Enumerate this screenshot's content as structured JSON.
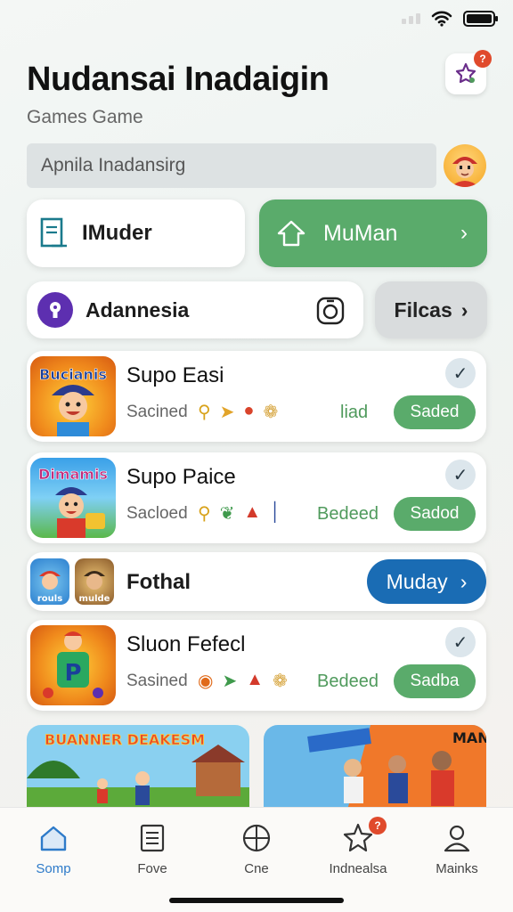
{
  "header": {
    "title": "Nudansai Inadaigin",
    "subtitle": "Games Game",
    "notification_count": "?"
  },
  "search": {
    "value": "Apnila Inadansirg"
  },
  "actions": {
    "primary_left_label": "IMuder",
    "primary_right_label": "MuMan",
    "secondary_left_label": "Adannesia",
    "secondary_right_label": "Filcas"
  },
  "games": [
    {
      "title": "Supo Easi",
      "thumb_text": "Bucianis",
      "meta": "Sacined",
      "status": "liad",
      "action": "Saded",
      "icons": [
        "key-icon",
        "horn-icon",
        "flame-icon",
        "shell-icon"
      ]
    },
    {
      "title": "Supo Paice",
      "thumb_text": "Dimamis",
      "meta": "Sacloed",
      "status": "Bedeed",
      "action": "Sadod",
      "icons": [
        "key-icon",
        "leaf-icon",
        "cone-icon",
        "pin-icon"
      ]
    },
    {
      "title": "Sluon Fefecl",
      "thumb_text": "P",
      "meta": "Sasined",
      "status": "Bedeed",
      "action": "Sadba",
      "icons": [
        "pumpkin-icon",
        "leaf-icon",
        "warning-icon",
        "pretzel-icon"
      ]
    }
  ],
  "featured": {
    "title": "Fothal",
    "thumb_text_1": "rouls",
    "thumb_text_2": "mulde",
    "action": "Muday"
  },
  "banners": [
    {
      "text": "BUANNER DEAKESM"
    },
    {
      "text": "MAN"
    }
  ],
  "tabs": [
    {
      "label": "Somp",
      "icon": "home-icon",
      "active": true
    },
    {
      "label": "Fove",
      "icon": "document-icon",
      "active": false
    },
    {
      "label": "Cne",
      "icon": "compass-icon",
      "active": false
    },
    {
      "label": "Indnealsa",
      "icon": "star-icon",
      "active": false,
      "badge": "?"
    },
    {
      "label": "Mainks",
      "icon": "person-icon",
      "active": false
    }
  ],
  "colors": {
    "accent_green": "#5aab6b",
    "accent_blue": "#1a6cb4",
    "badge_red": "#e04a2c",
    "tab_active": "#2d7ac9"
  }
}
